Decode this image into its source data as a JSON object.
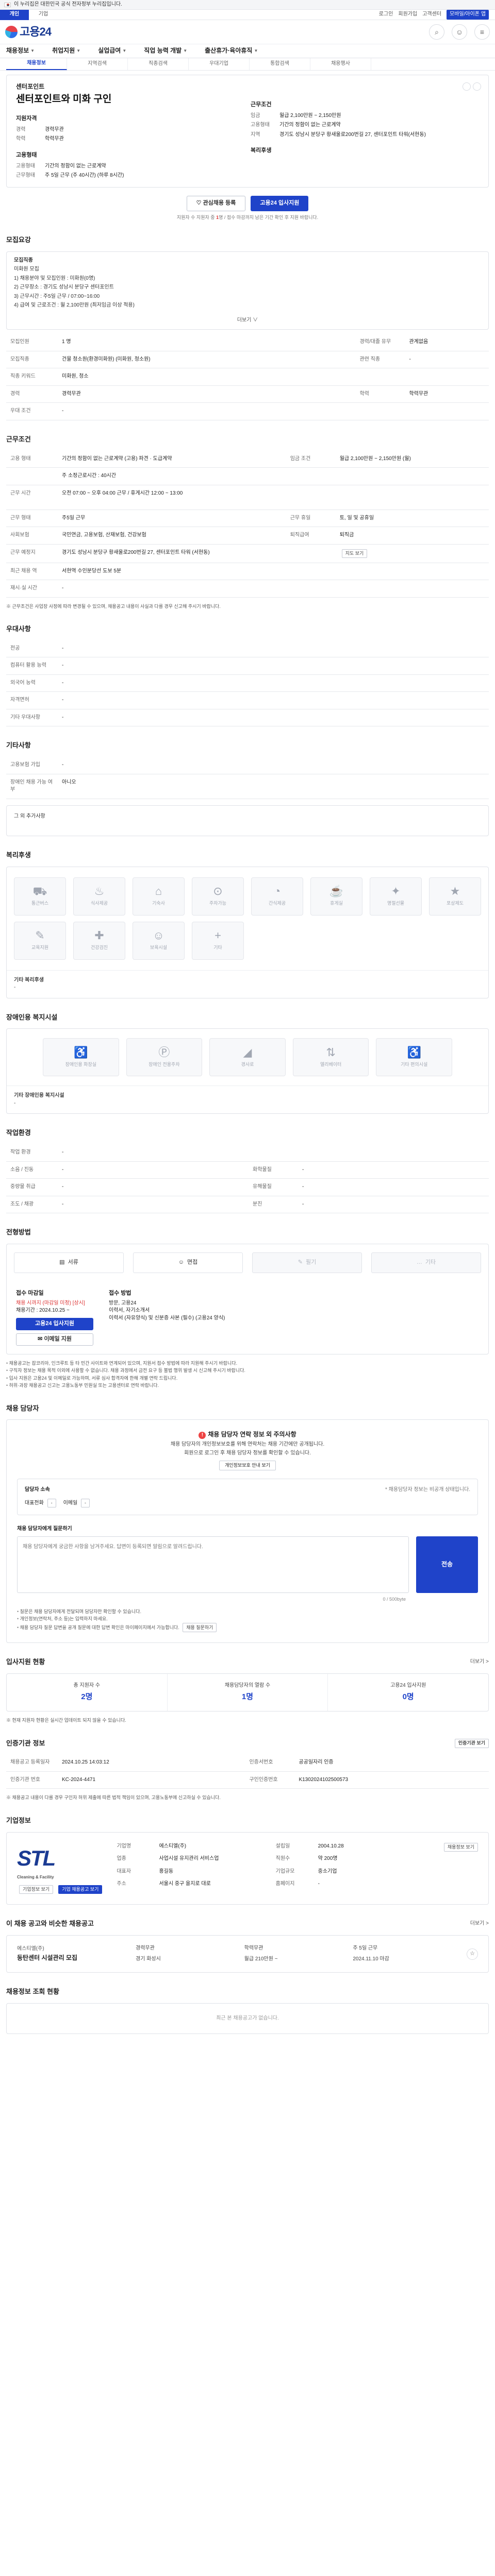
{
  "notice": {
    "text": "이 누리집은 대한민국 공식 전자정부 누리집입니다."
  },
  "topbar": {
    "tabs": [
      "개인",
      "기업"
    ],
    "right_links": [
      "로그인",
      "회원가입",
      "고객센터",
      "대국민 사이트맵"
    ],
    "corporate": "모바일/아이폰 앱"
  },
  "header": {
    "logo_text": "고용24",
    "icons": [
      "search-icon",
      "user-icon",
      "menu-icon"
    ]
  },
  "gnb": [
    "채용정보",
    "취업지원",
    "실업급여",
    "직업 능력 개발",
    "출산휴가·육아휴직"
  ],
  "subtabs": [
    "채용정보",
    "지역검색",
    "직종검색",
    "우대기업",
    "통합검색",
    "채용행사"
  ],
  "job": {
    "company": "센터포인트",
    "title": "센터포인트와 미화 구인",
    "left_section": "지원자격",
    "left_kv": [
      [
        "경력",
        "경력무관"
      ],
      [
        "학력",
        "학력무관"
      ]
    ],
    "right_section": "근무조건",
    "right_kv": [
      [
        "임금",
        "월급 2,100만원 ~ 2,150만원"
      ],
      [
        "고용형태",
        "기간의 정함이 없는 근로계약"
      ],
      [
        "지역",
        "경기도 성남시 분당구 황새울로200번길 27, 센터포인트 타워(서현동)"
      ]
    ],
    "left_section2": "고용형태",
    "left_kv2": [
      [
        "고용형태",
        "기간의 정함이 없는 근로계약"
      ],
      [
        "근무형태",
        "주 5일 근무 (주 40시간) (하루 8시간)"
      ]
    ],
    "right_section2": "복리후생",
    "btn_scrap": "관심채용 등록",
    "btn_apply": "고용24 입사지원",
    "apply_note_pre": "지원자 수 지원자 중 ",
    "apply_note_red": "1",
    "apply_note_post": "명 / 접수 마감까지 남은 기간 확인 후 지원 바랍니다."
  },
  "recruit": {
    "title": "모집요강",
    "lines": [
      "모집직종",
      "미화원 모집",
      "1) 채용분야 및 모집인원 : 미화원(0명)",
      "2) 근무장소 : 경기도 성남시 분당구 센터포인트",
      "3) 근무시간 : 주5일 근무 / 07:00~16:00",
      "4) 급여 및 근로조건 : 월 2,100만원 (최저임금 이상 적용)"
    ],
    "more": "더보기 ∨",
    "table": [
      [
        "모집인원",
        "1 명",
        "경력/대졸 유무",
        "관계없음"
      ],
      [
        "모집직종",
        "건물 청소원(환경미화원) (미화원, 청소원)",
        "관련 직종",
        "-"
      ],
      [
        "직종 키워드",
        "미화원, 청소"
      ],
      [
        "경력",
        "경력무관",
        "학력",
        "학력무관"
      ],
      [
        "우대 조건",
        "-"
      ]
    ]
  },
  "conditions": {
    "title": "근무조건",
    "rows": [
      {
        "k": "고용 형태",
        "v": "기간의 정함이 없는 근로계약 (고용) 파견 · 도급계약",
        "k2": "임금 조건",
        "v2": "월급 2,100만원 ~ 2,150만원 (월)"
      },
      {
        "k": "",
        "v": "주 소정근로시간 : 40시간",
        "k2": "",
        "v2": ""
      },
      {
        "k": "근무 시간",
        "v": "오전 07:00 ~ 오후 04:00 근무 / 휴게시간 12:00 ~ 13:00",
        "k2": "",
        "v2": ""
      },
      {
        "k": "근무 형태",
        "v": "주5일 근무",
        "k2": "근무 휴일",
        "v2": "토, 일 및 공휴일"
      },
      {
        "k": "사회보험",
        "v": "국민연금, 고용보험, 산재보험, 건강보험",
        "k2": "퇴직급여",
        "v2": "퇴직금"
      },
      {
        "k": "근무 예정지",
        "v": "경기도 성남시 분당구 황새울로200번길 27, 센터포인트 타워 (서현동)",
        "k2": "",
        "v2": "지도 보기"
      },
      {
        "k": "최근 채용 역",
        "v": "서현역 수인분당선 도보 5분",
        "k2": "",
        "v2": ""
      },
      {
        "k": "재시·실 시간",
        "v": "-",
        "k2": "",
        "v2": ""
      }
    ],
    "footnote": "※ 근무조건은 사업장 사정에 따라 변경될 수 있으며, 채용공고 내용이 사실과 다를 경우 신고해 주시기 바랍니다."
  },
  "prefer": {
    "title": "우대사항",
    "rows": [
      [
        "전공",
        "-"
      ],
      [
        "컴퓨터 활용 능력",
        "-"
      ],
      [
        "외국어 능력",
        "-"
      ],
      [
        "자격면허",
        "-"
      ],
      [
        "기타 우대사항",
        "-"
      ]
    ]
  },
  "extra": {
    "title": "기타사항",
    "rows": [
      [
        "고용보험 가입",
        "-"
      ],
      [
        "장애인 채용 가능 여부",
        "아니오"
      ]
    ],
    "box_label": "그 외 추가사항"
  },
  "welfare": {
    "title": "복리후생",
    "icons": [
      {
        "icon": "truck-icon",
        "label": "통근버스"
      },
      {
        "icon": "meal-icon",
        "label": "식사제공"
      },
      {
        "icon": "dorm-icon",
        "label": "기숙사"
      },
      {
        "icon": "car-icon",
        "label": "주차가능"
      },
      {
        "icon": "snack-icon",
        "label": "간식제공"
      },
      {
        "icon": "coffee-icon",
        "label": "휴게실"
      },
      {
        "icon": "gift-icon",
        "label": "명절선물"
      },
      {
        "icon": "award-icon",
        "label": "포상제도"
      },
      {
        "icon": "edu-icon",
        "label": "교육지원"
      },
      {
        "icon": "health-icon",
        "label": "건강검진"
      },
      {
        "icon": "child-icon",
        "label": "보육시설"
      },
      {
        "icon": "plus-icon",
        "label": "기타"
      }
    ],
    "other_label": "기타 복리후생",
    "other_value": "-"
  },
  "disability": {
    "title": "장애인용 복지시설",
    "icons": [
      {
        "icon": "toilet-icon",
        "label": "장애인용 화장실"
      },
      {
        "icon": "parking-icon",
        "label": "장애인 전용주차"
      },
      {
        "icon": "ramp-icon",
        "label": "경사로"
      },
      {
        "icon": "elevator-icon",
        "label": "엘리베이터"
      },
      {
        "icon": "wheel-icon",
        "label": "기타 편의시설"
      }
    ],
    "other_label": "기타 장애인용 복지시설",
    "other_value": "-"
  },
  "workplace": {
    "title": "작업환경",
    "rows": [
      [
        "작업 환경",
        "-",
        "",
        ""
      ],
      [
        "소음 / 진동",
        "-",
        "화학물질",
        "-"
      ],
      [
        "중량물 취급",
        "-",
        "유해물질",
        "-"
      ],
      [
        "조도 / 채광",
        "-",
        "분진",
        "-"
      ]
    ]
  },
  "process": {
    "title": "전형방법",
    "steps": [
      {
        "label": "서류",
        "dim": false
      },
      {
        "label": "면접",
        "dim": false
      },
      {
        "label": "필기",
        "dim": true
      },
      {
        "label": "기타",
        "dim": true
      }
    ]
  },
  "apply": {
    "method_title": "접수 마감일",
    "deadline_red": "채용 시까지 (마감일 미정) [상시]",
    "deadline_sub": "채용기간 : 2024.10.25 ~",
    "btn_apply": "고용24 입사지원",
    "btn_email": "이메일 지원",
    "doc_title": "접수 방법",
    "docs": [
      "방문, 고용24",
      "이력서, 자기소개서",
      "이력서 (자유양식) 및 신분증 사본 (필수) (고용24 양식)"
    ],
    "notes": [
      "채용공고는 잡코리아, 인크루트 등 타 민간 사이트와 연계되어 있으며, 지원서 접수 방법에 따라 지원해 주시기 바랍니다.",
      "구직자 정보는 채용 목적 이외에 사용할 수 없습니다. 채용 과정에서 금전 요구 등 불법 행위 발생 시 신고해 주시기 바랍니다.",
      "입사 지원은 고용24 및 이메일로 가능하며, 서류 심사 합격자에 한해 개별 연락 드립니다.",
      "허위·과장 채용공고 신고는 고용노동부 민원실 또는 고용센터로 연락 바랍니다."
    ]
  },
  "contact": {
    "title": "채용 담당자",
    "warn": "채용 담당자 연락 정보 외 주의사항",
    "lines": [
      "채용 담당자의 개인정보보호를 위해 연락처는 채용 기간에만 공개됩니다.",
      "회원으로 로그인 후 채용 담당자 정보를 확인할 수 있습니다."
    ],
    "login_btn": "개인정보보호 안내 보기",
    "card_title": "담당자 소속",
    "card_right": "* 채용담당자 정보는 비공개 상태입니다.",
    "card_rows": [
      [
        "대표전화",
        "-"
      ],
      [
        "이메일",
        "-"
      ]
    ],
    "qna_title": "채용 담당자에게 질문하기",
    "qna_placeholder": "채용 담당자에게 궁금한 사항을 남겨주세요. 답변이 등록되면 알림으로 알려드립니다.",
    "qna_send": "전송",
    "qna_count": "0 / 500byte",
    "qna_notes": [
      "질문은 채용 담당자에게 전달되며 담당자만 확인할 수 있습니다.",
      "개인정보(연락처, 주소 등)는 입력하지 마세요.",
      "채용 담당자 질문 답변을 공개 질문에 대한 답변 확인은 마이페이지에서 가능합니다."
    ],
    "qna_btn": "채용 질문하기"
  },
  "history": {
    "title": "입사지원 현황",
    "more": "더보기 >",
    "stats": [
      {
        "label": "총 지원자 수",
        "value": "2명"
      },
      {
        "label": "채용담당자의 열람 수",
        "value": "1명"
      },
      {
        "label": "고용24 입사지원",
        "value": "0명"
      }
    ],
    "note": "※ 현재 지원자 현황은 실시간 업데이트 되지 않을 수 있습니다."
  },
  "info": {
    "title": "인증기관 정보",
    "btn": "인증기관 보기",
    "rows": [
      [
        "채용공고 등록일자",
        "2024.10.25 14:03:12",
        "인증서번호",
        "공공일자리 인증"
      ],
      [
        "인증기관 번호",
        "KC-2024-4471",
        "구인인증번호",
        "K1302024102500573"
      ]
    ],
    "note": "※ 채용공고 내용이 다를 경우 구인자 허위 제출에 따른 법적 책임이 있으며, 고용노동부에 신고하실 수 있습니다."
  },
  "company": {
    "title": "기업정보",
    "logo": "STL",
    "logo_sub": "Cleaning & Facility",
    "btn_info": "기업정보 보기",
    "btn_more": "기업 채용공고 보기",
    "kv": [
      [
        "기업명",
        "에스티엘(주)"
      ],
      [
        "업종",
        "사업시설 유지관리 서비스업"
      ],
      [
        "설립일",
        "2004.10.28"
      ],
      [
        "직원수",
        "약 200명"
      ],
      [
        "대표자",
        "홍길동"
      ],
      [
        "주소",
        "서울시 중구 을지로 대로"
      ],
      [
        "기업규모",
        "중소기업"
      ],
      [
        "홈페이지",
        "-"
      ]
    ],
    "btn_homepage": "채용정보 보기"
  },
  "similar": {
    "title": "이 채용 공고와 비슷한 채용공고",
    "more": "더보기 >",
    "company": "에스티엘(주)",
    "job_title": "동탄센터 시설관리 모집",
    "tags": [
      "경력무관",
      "학력무관",
      "주 5일 근무",
      "경기 화성시",
      "월급 210만원 ~",
      "2024.11.10 마감"
    ]
  },
  "footer": {
    "title": "채용정보 조회 현황",
    "empty": "최근 본 채용공고가 없습니다."
  }
}
